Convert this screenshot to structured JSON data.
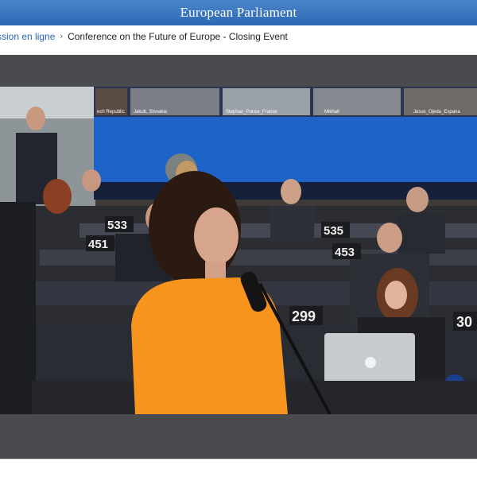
{
  "header": {
    "title": "European Parliament"
  },
  "breadcrumb": {
    "parent_link": "ssion en ligne",
    "separator": "›",
    "current": "Conference on the Future of Europe - Closing Event"
  },
  "video": {
    "screen_tiles": [
      "ech Republic",
      "Jakub, Slovakia",
      "Stephan_Ponce_France",
      "Mikhail",
      "",
      "Jesus_Ojeda_Espana"
    ],
    "desk_numbers": [
      "533",
      "535",
      "451",
      "453",
      "299",
      "30"
    ],
    "colors": {
      "accent": "#2c67b3",
      "speaker_shirt": "#f7941d",
      "screen": "#1e64c8"
    },
    "icons": [
      "apple-logo-icon",
      "eu-stars-icon",
      "microphone-icon"
    ]
  }
}
